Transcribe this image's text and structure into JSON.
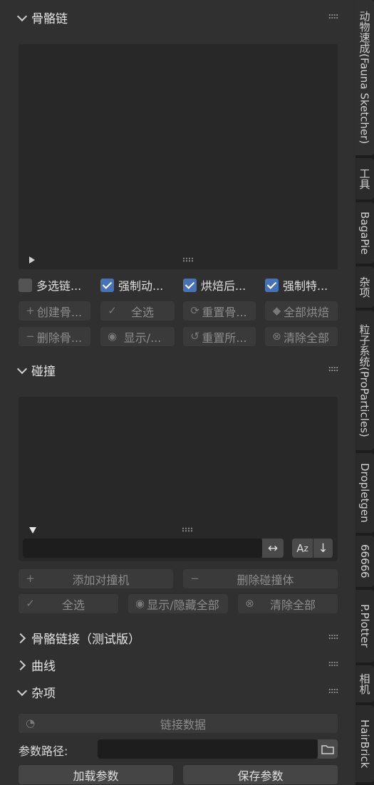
{
  "sections": {
    "bone_chain": {
      "title": "骨骼链"
    },
    "collision": {
      "title": "碰撞"
    },
    "bone_link": {
      "title": "骨骼链接（测试版）"
    },
    "curve": {
      "title": "曲线"
    },
    "misc": {
      "title": "杂项"
    }
  },
  "bone_chain": {
    "checkboxes": [
      {
        "label": "多选链...",
        "checked": false
      },
      {
        "label": "强制动...",
        "checked": true
      },
      {
        "label": "烘焙后...",
        "checked": true
      },
      {
        "label": "强制特...",
        "checked": true
      }
    ],
    "buttons_row1": [
      {
        "label": "创建骨...",
        "icon": "plus-icon"
      },
      {
        "label": "全选",
        "icon": "check-icon"
      },
      {
        "label": "重置骨...",
        "icon": "refresh-icon"
      },
      {
        "label": "全部烘焙",
        "icon": "diamond-icon"
      }
    ],
    "buttons_row2": [
      {
        "label": "删除骨...",
        "icon": "minus-icon"
      },
      {
        "label": "显示/...",
        "icon": "eye-icon"
      },
      {
        "label": "重置所...",
        "icon": "reset-all-icon"
      },
      {
        "label": "清除全部",
        "icon": "x-circle-icon"
      }
    ]
  },
  "collision": {
    "filter_value": "",
    "add_label": "添加对撞机",
    "remove_label": "删除碰撞体",
    "select_all": "全选",
    "toggle_all": "显示/隐藏全部",
    "clear_all": "清除全部"
  },
  "misc": {
    "link_data": "链接数据",
    "param_path_label": "参数路径:",
    "param_path_value": "",
    "load_params": "加载参数",
    "save_params": "保存参数"
  },
  "tabs": [
    "动物速成(Fauna Sketcher)",
    "工具",
    "BagaPie",
    "杂项",
    "粒子系统(ProParticles)",
    "Dropletgen",
    "66666",
    "P.Plotter",
    "相机",
    "HairBrick"
  ],
  "colors": {
    "checkbox_on": "#4772b3",
    "panel_bg": "#303030",
    "list_bg": "#282828"
  }
}
